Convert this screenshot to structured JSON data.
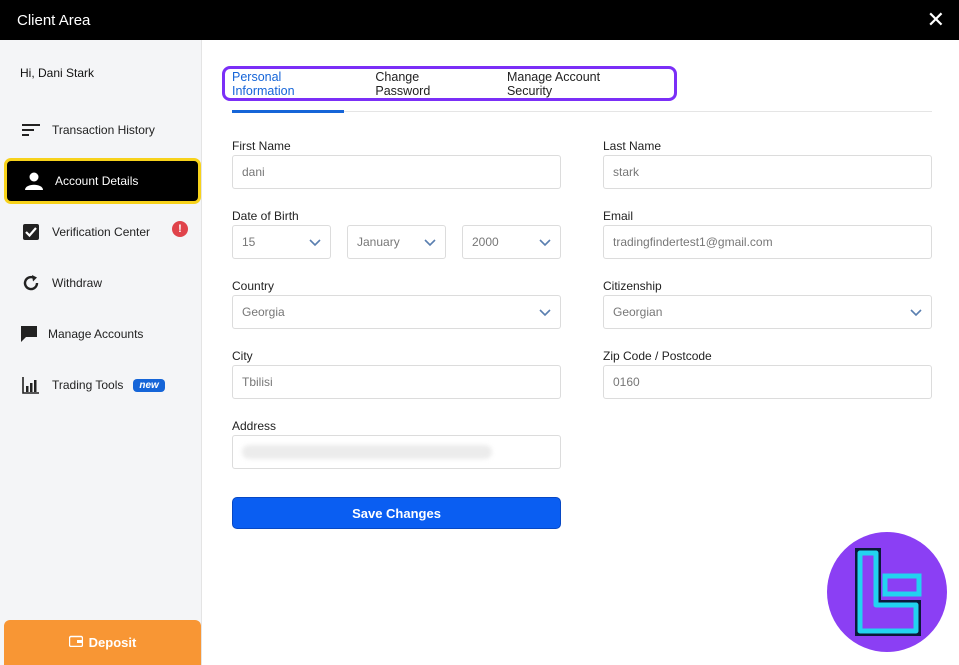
{
  "window": {
    "title": "Client Area",
    "close_glyph": "✕"
  },
  "sidebar": {
    "greeting": "Hi,  Dani   Stark",
    "items": [
      {
        "label": "Transaction History",
        "icon": "sort-lines-icon"
      },
      {
        "label": "Account Details",
        "icon": "user-icon"
      },
      {
        "label": "Verification Center",
        "icon": "checkbox-icon",
        "alert": "!"
      },
      {
        "label": "Withdraw",
        "icon": "refresh-icon"
      },
      {
        "label": "Manage Accounts",
        "icon": "chat-icon"
      },
      {
        "label": "Trading Tools",
        "icon": "bar-chart-icon",
        "badge": "new"
      }
    ],
    "deposit_label": "Deposit"
  },
  "tabs": [
    {
      "label": "Personal Information",
      "active": true
    },
    {
      "label": "Change Password",
      "active": false
    },
    {
      "label": "Manage Account Security",
      "active": false
    }
  ],
  "form": {
    "first_name": {
      "label": "First Name",
      "value": "dani"
    },
    "last_name": {
      "label": "Last Name",
      "value": "stark"
    },
    "dob": {
      "label": "Date of Birth",
      "day": "15",
      "month": "January",
      "year": "2000"
    },
    "email": {
      "label": "Email",
      "value": "tradingfindertest1@gmail.com"
    },
    "country": {
      "label": "Country",
      "value": "Georgia"
    },
    "citizenship": {
      "label": "Citizenship",
      "value": "Georgian"
    },
    "city": {
      "label": "City",
      "value": "Tbilisi"
    },
    "zip": {
      "label": "Zip Code / Postcode",
      "value": "0160"
    },
    "address": {
      "label": "Address",
      "value": ""
    },
    "save_label": "Save Changes"
  },
  "colors": {
    "accent": "#1565d8",
    "active_border": "#f7d21b",
    "tab_highlight": "#7b2ff7",
    "deposit": "#f89634",
    "save": "#0a5ef2",
    "logo_bg": "#8b3ff4",
    "logo_fg": "#22d3f0"
  }
}
